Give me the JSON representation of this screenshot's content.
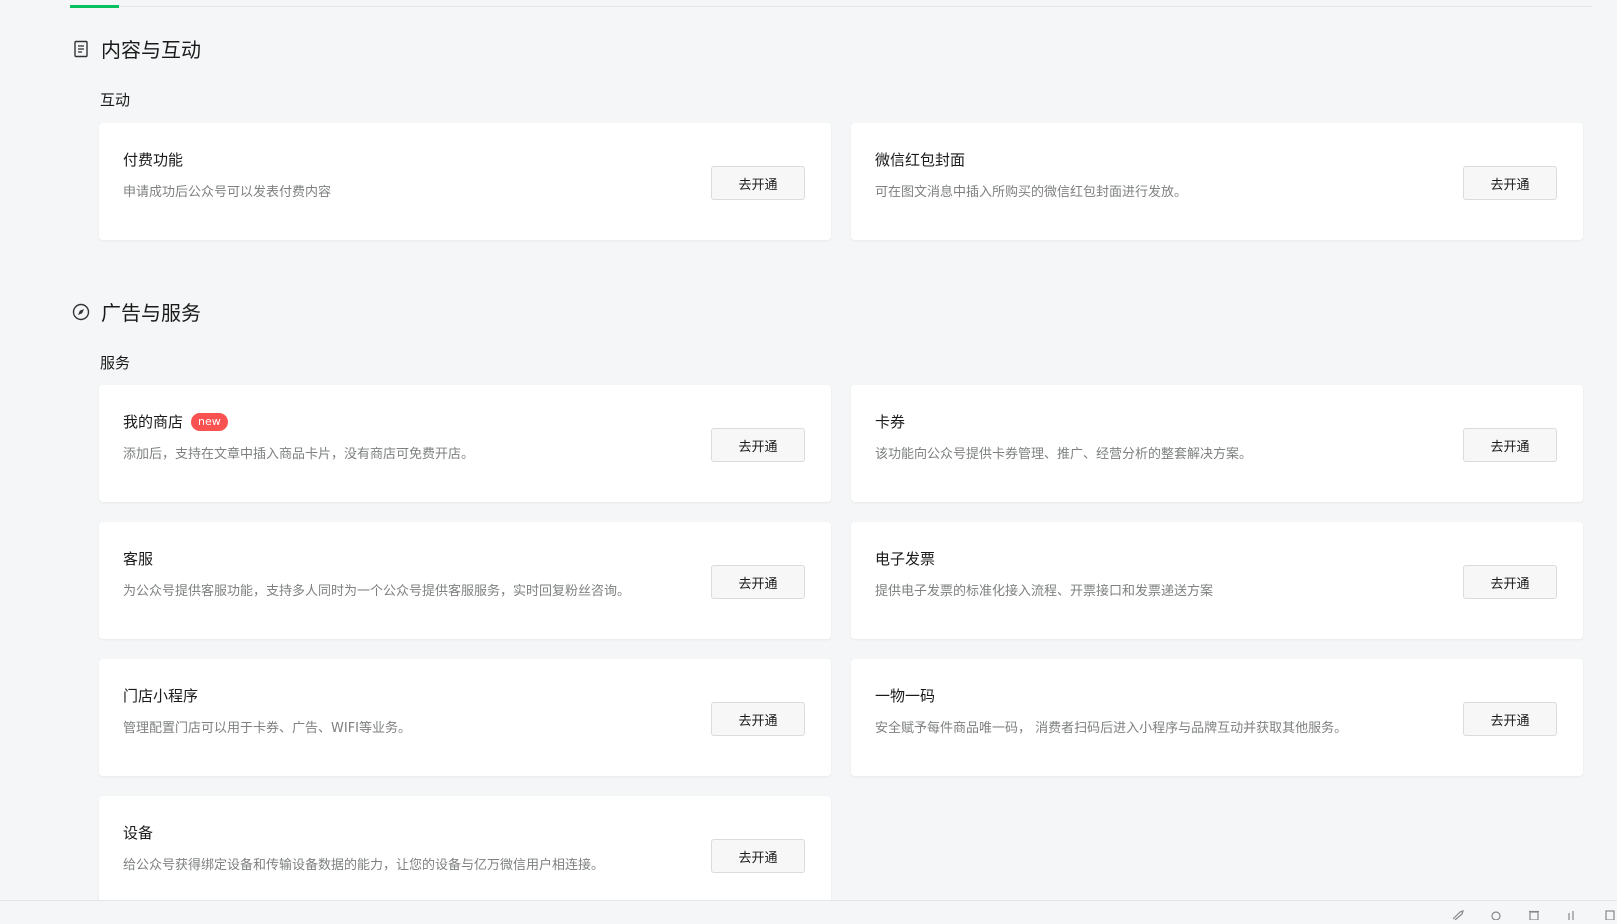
{
  "sections": [
    {
      "title": "内容与互动",
      "icon": "document-icon",
      "subtitle": "互动",
      "cards": [
        {
          "name": "付费功能",
          "desc": "申请成功后公众号可以发表付费内容",
          "button": "去开通"
        },
        {
          "name": "微信红包封面",
          "desc": "可在图文消息中插入所购买的微信红包封面进行发放。",
          "button": "去开通"
        }
      ]
    },
    {
      "title": "广告与服务",
      "icon": "compass-icon",
      "subtitle": "服务",
      "cards": [
        {
          "name": "我的商店",
          "badge": "new",
          "desc": "添加后，支持在文章中插入商品卡片，没有商店可免费开店。",
          "button": "去开通"
        },
        {
          "name": "卡券",
          "desc": "该功能向公众号提供卡券管理、推广、经营分析的整套解决方案。",
          "button": "去开通"
        },
        {
          "name": "客服",
          "desc": "为公众号提供客服功能，支持多人同时为一个公众号提供客服服务，实时回复粉丝咨询。",
          "button": "去开通"
        },
        {
          "name": "电子发票",
          "desc": "提供电子发票的标准化接入流程、开票接口和发票递送方案",
          "button": "去开通"
        },
        {
          "name": "门店小程序",
          "desc": "管理配置门店可以用于卡券、广告、WIFI等业务。",
          "button": "去开通"
        },
        {
          "name": "一物一码",
          "desc": "安全赋予每件商品唯一码， 消费者扫码后进入小程序与品牌互动并获取其他服务。",
          "button": "去开通"
        },
        {
          "name": "设备",
          "desc": "给公众号获得绑定设备和传输设备数据的能力，让您的设备与亿万微信用户相连接。",
          "button": "去开通"
        }
      ]
    }
  ],
  "colors": {
    "accent": "#07c160",
    "badge": "#fa5151"
  }
}
